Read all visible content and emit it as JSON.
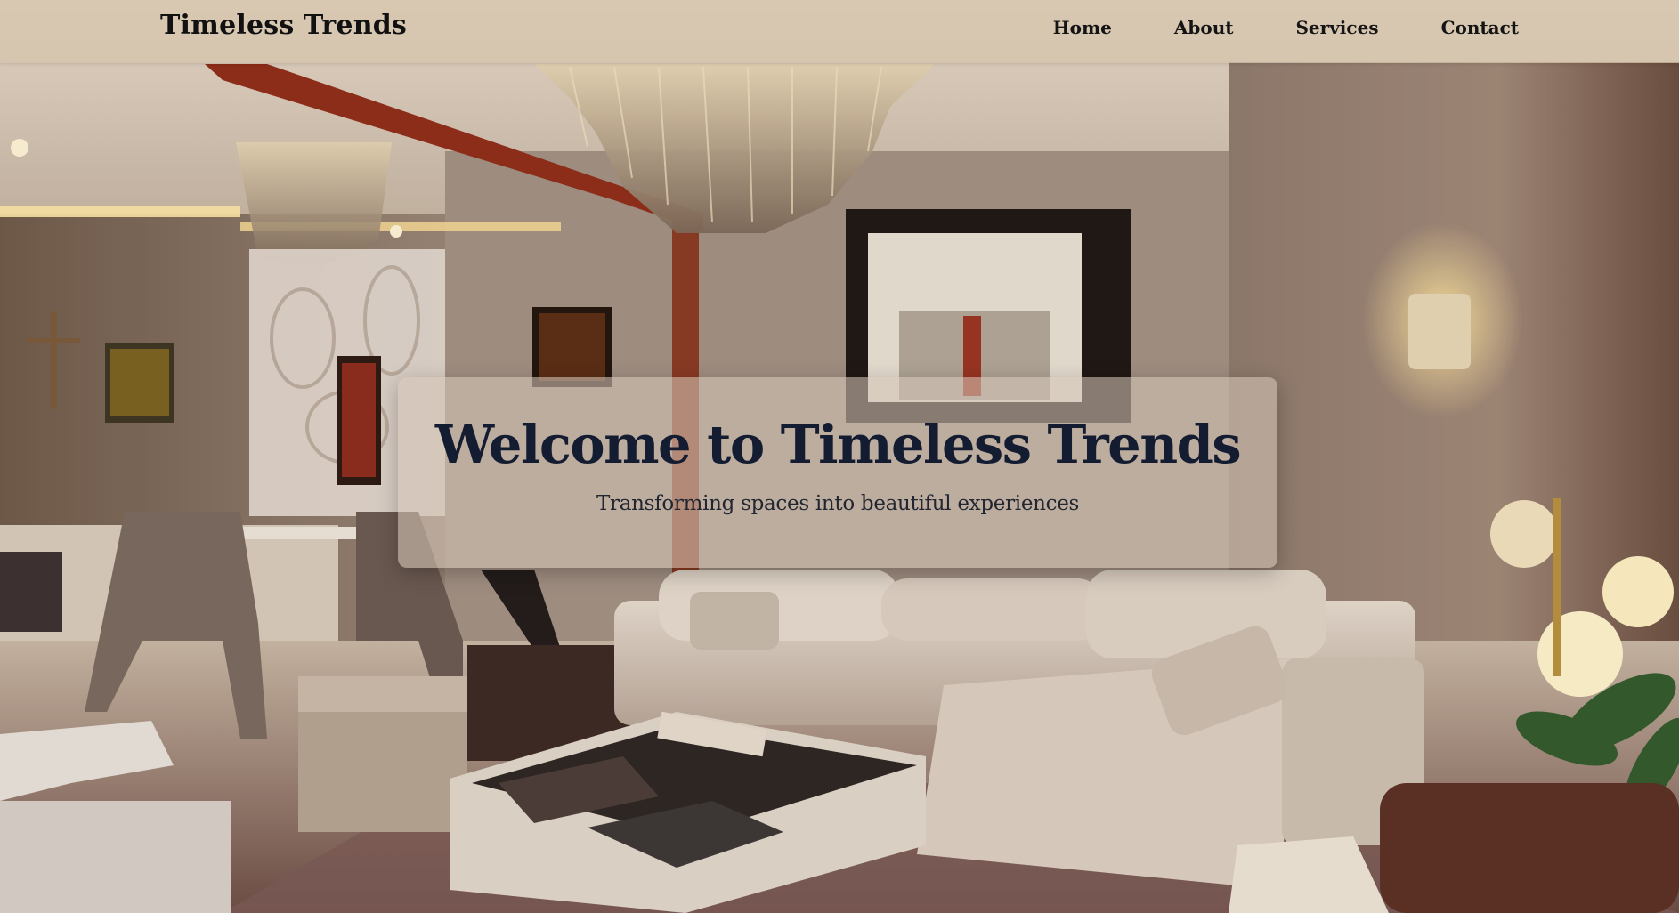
{
  "header": {
    "brand": "Timeless Trends",
    "nav": [
      {
        "label": "Home"
      },
      {
        "label": "About"
      },
      {
        "label": "Services"
      },
      {
        "label": "Contact"
      }
    ]
  },
  "hero": {
    "title": "Welcome to Timeless Trends",
    "subtitle": "Transforming spaces into beautiful experiences",
    "background": "living-room-photo"
  },
  "colors": {
    "navbar_bg": "#d6c4ac",
    "title_color": "#131c30",
    "text_color": "#141414"
  }
}
